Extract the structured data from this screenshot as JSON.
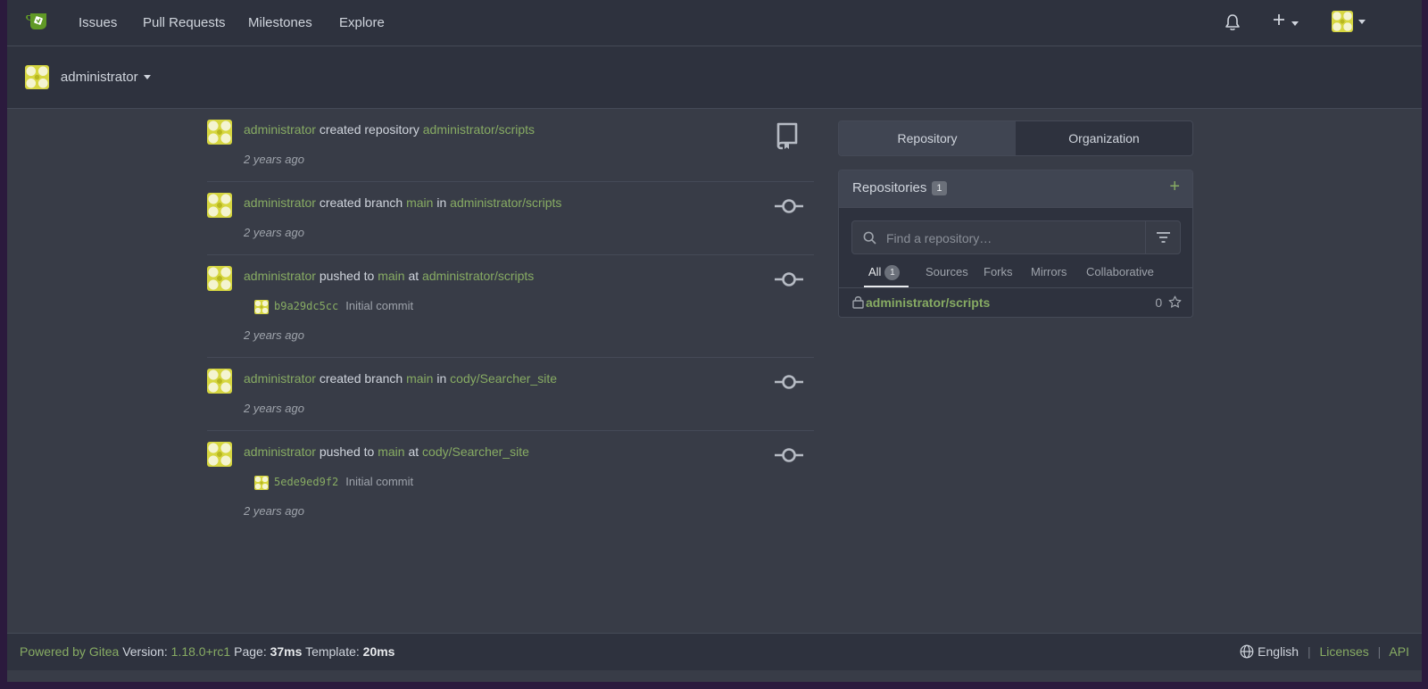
{
  "nav": {
    "items": [
      "Issues",
      "Pull Requests",
      "Milestones",
      "Explore"
    ],
    "notification_icon": "bell-icon",
    "create_icon": "plus-icon"
  },
  "context": {
    "user": "administrator"
  },
  "feed": [
    {
      "actor": "administrator",
      "action": "created repository",
      "target": "administrator/scripts",
      "time": "2 years ago",
      "icon": "repo-icon"
    },
    {
      "actor": "administrator",
      "action": "created branch",
      "branch": "main",
      "prep": "in",
      "target": "administrator/scripts",
      "time": "2 years ago",
      "icon": "git-commit-icon"
    },
    {
      "actor": "administrator",
      "action": "pushed to",
      "branch": "main",
      "prep": "at",
      "target": "administrator/scripts",
      "commit_sha": "b9a29dc5cc",
      "commit_msg": "Initial commit",
      "time": "2 years ago",
      "icon": "git-commit-icon"
    },
    {
      "actor": "administrator",
      "action": "created branch",
      "branch": "main",
      "prep": "in",
      "target": "cody/Searcher_site",
      "time": "2 years ago",
      "icon": "git-commit-icon"
    },
    {
      "actor": "administrator",
      "action": "pushed to",
      "branch": "main",
      "prep": "at",
      "target": "cody/Searcher_site",
      "commit_sha": "5ede9ed9f2",
      "commit_msg": "Initial commit",
      "time": "2 years ago",
      "icon": "git-commit-icon"
    }
  ],
  "sidebar": {
    "tabs": [
      "Repository",
      "Organization"
    ],
    "repos_title": "Repositories",
    "repos_count": "1",
    "search_placeholder": "Find a repository…",
    "filter_tabs": [
      "All",
      "Sources",
      "Forks",
      "Mirrors",
      "Collaborative"
    ],
    "all_count": "1",
    "repos": [
      {
        "name": "administrator/scripts",
        "stars": "0"
      }
    ]
  },
  "footer": {
    "powered_by": "Powered by Gitea",
    "version_label": "Version:",
    "version": "1.18.0+rc1",
    "page_label": "Page:",
    "page_time": "37ms",
    "template_label": "Template:",
    "template_time": "20ms",
    "language": "English",
    "licenses": "Licenses",
    "api": "API"
  },
  "colors": {
    "accent": "#87ab63",
    "background": "#383c47",
    "navbar": "#2e323e"
  }
}
